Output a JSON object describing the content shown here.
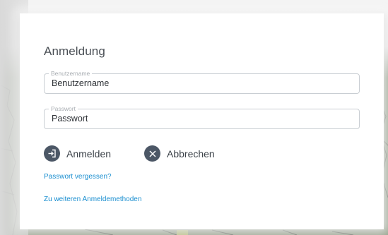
{
  "dialog": {
    "title": "Anmeldung",
    "username": {
      "label": "Benutzername",
      "placeholder": "Benutzername",
      "value": ""
    },
    "password": {
      "label": "Passwort",
      "placeholder": "Passwort",
      "value": ""
    },
    "login_button": {
      "label": "Anmelden",
      "icon": "login-icon"
    },
    "cancel_button": {
      "label": "Abbrechen",
      "icon": "close-icon"
    },
    "forgot_link": "Passwort vergessen?",
    "more_methods_link": "Zu weiteren Anmeldemethoden"
  },
  "colors": {
    "accent_link": "#1b8fd0",
    "button_icon_bg": "#4c5766",
    "title_text": "#4a4f55",
    "field_border": "#c9ced3"
  }
}
